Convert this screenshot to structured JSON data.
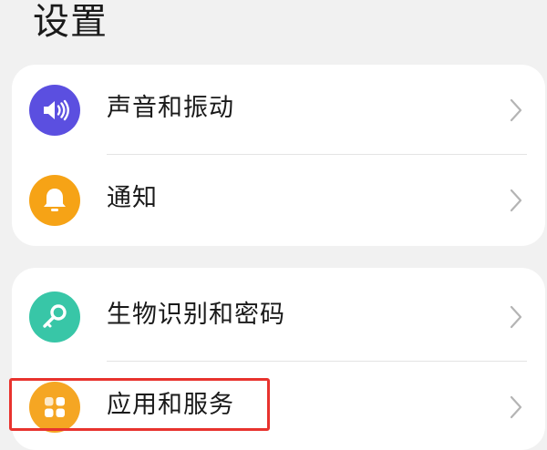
{
  "header": {
    "title": "设置"
  },
  "groups": [
    {
      "items": [
        {
          "label": "声音和振动",
          "icon": "speaker-volume-icon",
          "icon_color": "#5b4fe0"
        },
        {
          "label": "通知",
          "icon": "bell-icon",
          "icon_color": "#f6a316"
        }
      ]
    },
    {
      "items": [
        {
          "label": "生物识别和密码",
          "icon": "key-icon",
          "icon_color": "#38c6a7"
        },
        {
          "label": "应用和服务",
          "icon": "apps-grid-icon",
          "icon_color": "#f5a623"
        }
      ]
    }
  ],
  "annotation": {
    "highlight_color": "#e8332e",
    "highlighted_item": "应用和服务"
  }
}
